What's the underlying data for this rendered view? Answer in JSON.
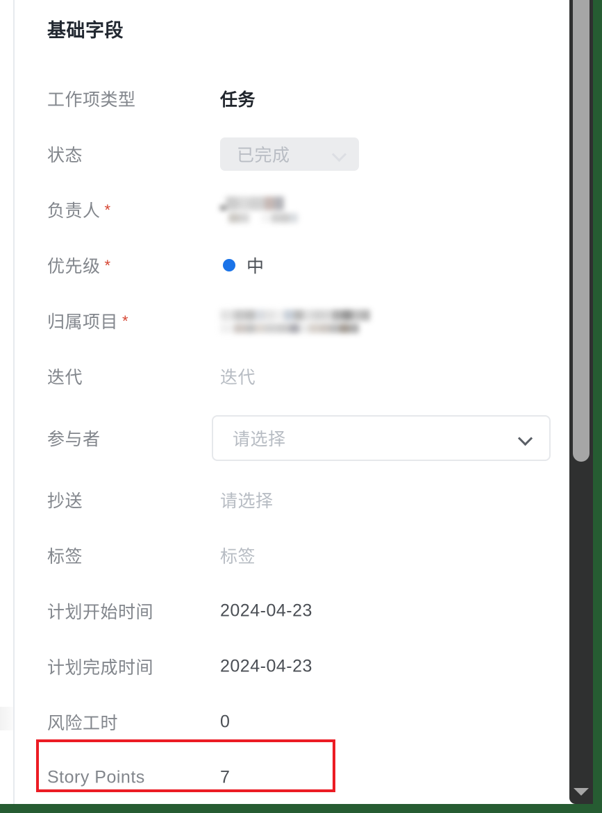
{
  "panel": {
    "section_title": "基础字段"
  },
  "fields": [
    {
      "label": "工作项类型",
      "required": false,
      "type": "text-bold",
      "value": "任务",
      "name": "work-item-type"
    },
    {
      "label": "状态",
      "required": false,
      "type": "status-pill",
      "value": "已完成",
      "icon": "chevron-down-icon",
      "name": "status"
    },
    {
      "label": "负责人",
      "required": true,
      "type": "redacted",
      "value": "",
      "name": "assignee"
    },
    {
      "label": "优先级",
      "required": true,
      "type": "priority",
      "value": "中",
      "dot_color": "#1a73e8",
      "name": "priority"
    },
    {
      "label": "归属项目",
      "required": true,
      "type": "redacted",
      "value": "",
      "name": "belonging-project"
    },
    {
      "label": "迭代",
      "required": false,
      "type": "placeholder",
      "value": "迭代",
      "name": "iteration"
    },
    {
      "label": "参与者",
      "required": false,
      "type": "select",
      "value": "请选择",
      "icon": "chevron-down-icon",
      "name": "participants"
    },
    {
      "label": "抄送",
      "required": false,
      "type": "placeholder",
      "value": "请选择",
      "name": "cc"
    },
    {
      "label": "标签",
      "required": false,
      "type": "placeholder",
      "value": "标签",
      "name": "tags"
    },
    {
      "label": "计划开始时间",
      "required": false,
      "type": "text",
      "value": "2024-04-23",
      "name": "planned-start-time"
    },
    {
      "label": "计划完成时间",
      "required": false,
      "type": "text",
      "value": "2024-04-23",
      "name": "planned-end-time"
    },
    {
      "label": "风险工时",
      "required": false,
      "type": "text",
      "value": "0",
      "name": "risk-hours"
    },
    {
      "label": "Story Points",
      "required": false,
      "type": "text",
      "value": "7",
      "name": "story-points",
      "highlighted": true
    }
  ],
  "scrollbar": {
    "down_arrow_icon": "triangle-down-icon"
  },
  "annotation": {
    "color": "#ec1c24",
    "target": "Story Points"
  },
  "colors": {
    "accent_blue": "#1a73e8",
    "required_asterisk": "#d64532",
    "window_border_green": "#265c32",
    "label_gray": "#82868c",
    "placeholder_gray": "#b7bcc3"
  }
}
